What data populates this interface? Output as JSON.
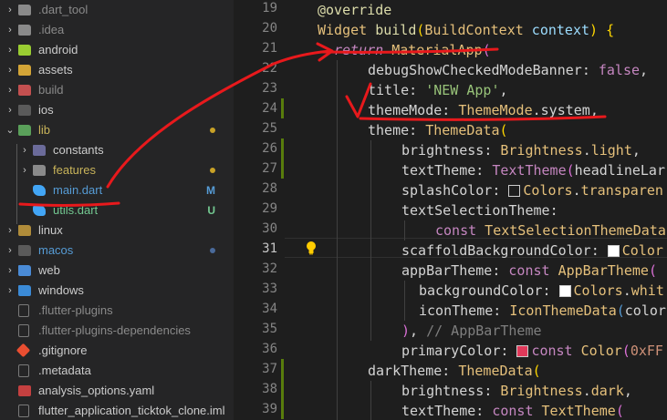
{
  "explorer": {
    "items": [
      {
        "label": ".dart_tool",
        "icon": "folder-icon",
        "chevron": "›",
        "badge": "",
        "color": "#8a8a8a"
      },
      {
        "label": ".idea",
        "icon": "folder-icon",
        "chevron": "›",
        "badge": "",
        "color": "#8a8a8a"
      },
      {
        "label": "android",
        "icon": "android-folder-icon",
        "chevron": "›",
        "badge": "",
        "color": "#cccccc"
      },
      {
        "label": "assets",
        "icon": "assets-folder-icon",
        "chevron": "›",
        "badge": "",
        "color": "#cccccc"
      },
      {
        "label": "build",
        "icon": "build-folder-icon",
        "chevron": "›",
        "badge": "",
        "color": "#8a8a8a"
      },
      {
        "label": "ios",
        "icon": "ios-folder-icon",
        "chevron": "›",
        "badge": "",
        "color": "#cccccc"
      },
      {
        "label": "lib",
        "icon": "lib-folder-icon",
        "chevron": "⌄",
        "badge": "",
        "color": "#c9b45a"
      },
      {
        "label": "constants",
        "icon": "constants-folder-icon",
        "chevron": "›",
        "badge": "",
        "color": "#cccccc"
      },
      {
        "label": "features",
        "icon": "folder-icon",
        "chevron": "›",
        "badge": "",
        "color": "#c9b45a"
      },
      {
        "label": "main.dart",
        "icon": "dart-file-icon",
        "chevron": "",
        "badge": "M",
        "color": "#569cd6"
      },
      {
        "label": "utils.dart",
        "icon": "dart-file-icon",
        "chevron": "",
        "badge": "U",
        "color": "#73c991"
      },
      {
        "label": "linux",
        "icon": "linux-folder-icon",
        "chevron": "›",
        "badge": "",
        "color": "#cccccc"
      },
      {
        "label": "macos",
        "icon": "macos-folder-icon",
        "chevron": "›",
        "badge": "",
        "color": "#569cd6"
      },
      {
        "label": "web",
        "icon": "web-folder-icon",
        "chevron": "›",
        "badge": "",
        "color": "#cccccc"
      },
      {
        "label": "windows",
        "icon": "windows-folder-icon",
        "chevron": "›",
        "badge": "",
        "color": "#cccccc"
      },
      {
        "label": ".flutter-plugins",
        "icon": "file-icon",
        "chevron": "",
        "badge": "",
        "color": "#8a8a8a"
      },
      {
        "label": ".flutter-plugins-dependencies",
        "icon": "file-icon",
        "chevron": "",
        "badge": "",
        "color": "#8a8a8a"
      },
      {
        "label": ".gitignore",
        "icon": "git-icon",
        "chevron": "",
        "badge": "",
        "color": "#cccccc"
      },
      {
        "label": ".metadata",
        "icon": "file-icon",
        "chevron": "",
        "badge": "",
        "color": "#cccccc"
      },
      {
        "label": "analysis_options.yaml",
        "icon": "yaml-file-icon",
        "chevron": "",
        "badge": "",
        "color": "#cccccc"
      },
      {
        "label": "flutter_application_ticktok_clone.iml",
        "icon": "file-icon",
        "chevron": "",
        "badge": "",
        "color": "#cccccc"
      }
    ]
  },
  "editor": {
    "line_numbers": [
      "19",
      "20",
      "21",
      "22",
      "23",
      "24",
      "25",
      "26",
      "27",
      "28",
      "29",
      "30",
      "31",
      "32",
      "33",
      "34",
      "35",
      "36",
      "37",
      "38",
      "39",
      "40"
    ],
    "active_line": "31",
    "code": {
      "l19": {
        "a": "@override"
      },
      "l20": {
        "a": "Widget",
        "b": " build",
        "c": "(",
        "d": "BuildContext",
        "e": " context",
        "f": ")",
        "g": " {"
      },
      "l21": {
        "a": "return",
        "b": " MaterialApp",
        "c": "("
      },
      "l22": {
        "a": "debugShowCheckedModeBanner",
        "b": ": ",
        "c": "false",
        "d": ","
      },
      "l23": {
        "a": "title",
        "b": ": ",
        "c": "'NEW App'",
        "d": ","
      },
      "l24": {
        "a": "themeMode",
        "b": ": ",
        "c": "ThemeMode",
        "d": ".",
        "e": "system",
        "f": ","
      },
      "l25": {
        "a": "theme",
        "b": ": ",
        "c": "ThemeData",
        "d": "("
      },
      "l26": {
        "a": "brightness",
        "b": ": ",
        "c": "Brightness",
        "d": ".",
        "e": "light",
        "f": ","
      },
      "l27": {
        "a": "textTheme",
        "b": ": ",
        "c": "TextTheme",
        "d": "(",
        "e": "headlineLar"
      },
      "l28": {
        "a": "splashColor",
        "b": ": ",
        "c": "Colors",
        "d": ".",
        "e": "transparen"
      },
      "l29": {
        "a": "textSelectionTheme",
        "b": ":"
      },
      "l30": {
        "a": "const",
        "b": " TextSelectionThemeData"
      },
      "l31": {
        "a": "scaffoldBackgroundColor",
        "b": ": ",
        "c": "Color"
      },
      "l32": {
        "a": "appBarTheme",
        "b": ": ",
        "c": "const",
        "d": " AppBarTheme",
        "e": "("
      },
      "l33": {
        "a": "backgroundColor",
        "b": ": ",
        "c": "Colors",
        "d": ".",
        "e": "whit"
      },
      "l34": {
        "a": "iconTheme",
        "b": ": ",
        "c": "IconThemeData",
        "d": "(",
        "e": "color"
      },
      "l35": {
        "a": ")",
        "b": ", ",
        "c": "// AppBarTheme"
      },
      "l36": {
        "a": "primaryColor",
        "b": ": ",
        "c": "const",
        "d": " Color",
        "e": "(",
        "f": "0xFF"
      },
      "l37": {
        "a": "darkTheme",
        "b": ": ",
        "c": "ThemeData",
        "d": "("
      },
      "l38": {
        "a": "brightness",
        "b": ": ",
        "c": "Brightness",
        "d": ".",
        "e": "dark",
        "f": ","
      },
      "l39": {
        "a": "textTheme",
        "b": ": ",
        "c": "const",
        "d": " TextTheme",
        "e": "("
      }
    },
    "swatches": {
      "transparent": "#1e1e1e",
      "white": "#ffffff",
      "primary": "#e0395a"
    },
    "lightbulb_icon": "lightbulb-icon"
  },
  "colors": {
    "annotation": "#e8191c",
    "modified_badge": "#569cd6",
    "untracked_badge": "#73c991",
    "folder_dot": "#c9a227",
    "editor_bg": "#1e1e1e",
    "sidebar_bg": "#252526"
  }
}
